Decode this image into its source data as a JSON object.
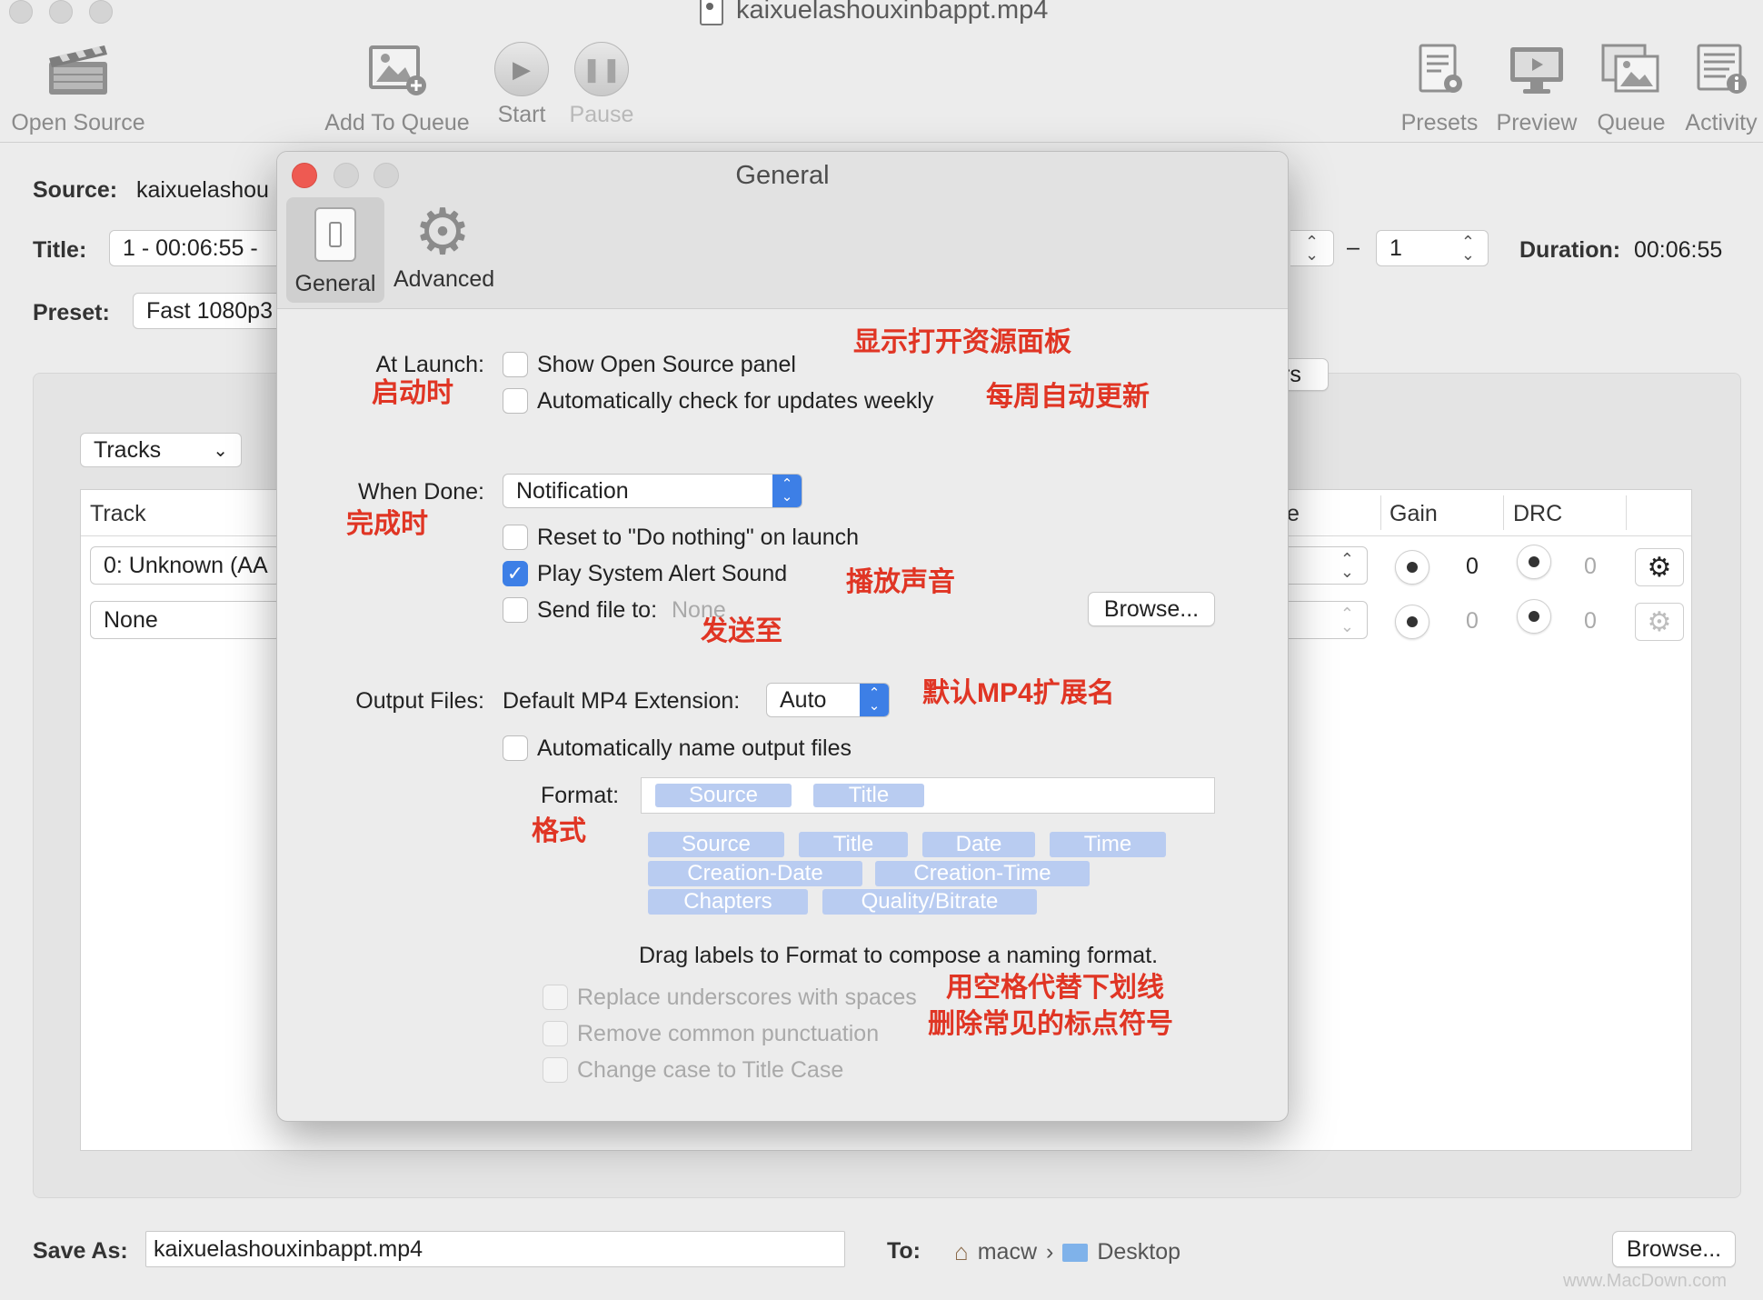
{
  "window": {
    "title": "kaixuelashouxinbappt.mp4"
  },
  "toolbar": {
    "open_source": "Open Source",
    "add_to_queue": "Add To Queue",
    "start": "Start",
    "pause": "Pause",
    "presets": "Presets",
    "preview": "Preview",
    "queue": "Queue",
    "activity": "Activity"
  },
  "main": {
    "source_label": "Source:",
    "source_value": "kaixuelashou",
    "title_label": "Title:",
    "title_value": "1 - 00:06:55 -",
    "chapter_end": "1",
    "range_dash": "–",
    "duration_label": "Duration:",
    "duration_value": "00:06:55",
    "preset_label": "Preset:",
    "preset_value": "Fast 1080p3",
    "tab_fragment": "rs",
    "tracks_popup": "Tracks",
    "table": {
      "col_track": "Track",
      "col_rate_fragment": "te",
      "col_gain": "Gain",
      "col_drc": "DRC",
      "rows": [
        {
          "track": "0: Unknown (AA",
          "gain": "0",
          "drc": "0"
        },
        {
          "track": "None",
          "gain": "0",
          "drc": "0"
        }
      ]
    },
    "save_as_label": "Save As:",
    "save_as_value": "kaixuelashouxinbappt.mp4",
    "to_label": "To:",
    "path_home": "macw",
    "path_sep": "›",
    "path_folder": "Desktop",
    "browse": "Browse..."
  },
  "dialog": {
    "title": "General",
    "tabs": [
      {
        "label": "General"
      },
      {
        "label": "Advanced"
      }
    ],
    "at_launch_label": "At Launch:",
    "show_open_source": "Show Open Source panel",
    "auto_check_updates": "Automatically check for updates weekly",
    "when_done_label": "When Done:",
    "when_done_value": "Notification",
    "reset_do_nothing": "Reset to \"Do nothing\" on launch",
    "play_alert": "Play System Alert Sound",
    "send_file": "Send file to:",
    "send_file_value": "None",
    "browse": "Browse...",
    "output_files_label": "Output Files:",
    "default_ext_label": "Default MP4 Extension:",
    "default_ext_value": "Auto",
    "auto_name": "Automatically name output files",
    "format_label": "Format:",
    "format_tokens": [
      "Source",
      "Title"
    ],
    "available_tokens": [
      "Source",
      "Title",
      "Date",
      "Time",
      "Creation-Date",
      "Creation-Time",
      "Chapters",
      "Quality/Bitrate"
    ],
    "drag_hint": "Drag labels to Format to compose a naming format.",
    "replace_underscores": "Replace underscores with spaces",
    "remove_punctuation": "Remove common punctuation",
    "change_case": "Change case to Title Case"
  },
  "annotations": {
    "show_panel": "显示打开资源面板",
    "at_launch": "启动时",
    "weekly_update": "每周自动更新",
    "when_done": "完成时",
    "play_sound": "播放声音",
    "send_to": "发送至",
    "default_ext": "默认MP4扩展名",
    "format": "格式",
    "replace_underscores": "用空格代替下划线",
    "remove_punctuation": "删除常见的标点符号"
  },
  "watermark": "www.MacDown.com",
  "colors": {
    "accent": "#3d7fe6",
    "annotation": "#e03524",
    "token": "#b9ccf1"
  }
}
